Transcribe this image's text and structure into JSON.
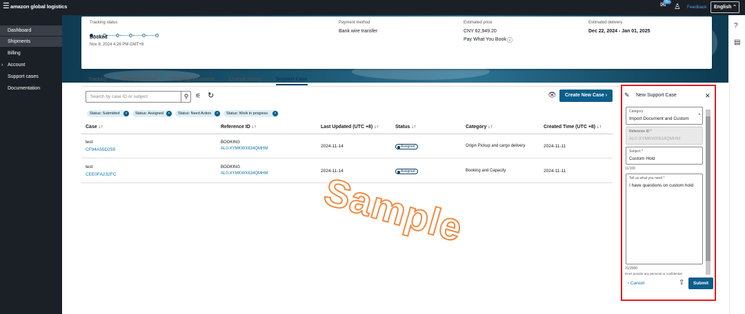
{
  "topbar": {
    "menu_icon": "hamburger-icon",
    "brand": "amazon global logistics",
    "gift_badge": "99+",
    "feedback": "Feedback",
    "language": "English"
  },
  "sidenav": {
    "items": [
      {
        "label": "Dashboard",
        "active": true
      },
      {
        "label": "Shipments",
        "active": true
      },
      {
        "label": "Billing",
        "active": false
      },
      {
        "label": "Account",
        "active": false,
        "expandable": true
      },
      {
        "label": "Support cases",
        "active": false
      },
      {
        "label": "Documentation",
        "active": false
      }
    ]
  },
  "summary": {
    "tracking_status_label": "Tracking status",
    "tracking_status_value": "Booked",
    "tracking_status_time": "Nov 8, 2024 4:26 PM GMT+8",
    "payment_method_label": "Payment method",
    "payment_method_value": "Bank wire transfer",
    "estimated_price_label": "Estimated price",
    "estimated_price_value": "CNY 62,949.20",
    "pay_what_you_book": "Pay What You Book",
    "estimated_delivery_label": "Estimated delivery",
    "estimated_delivery_value": "Dec 22, 2024 - Jan 01, 2025"
  },
  "tabs": [
    "Tracking",
    "Shipment details",
    "Shipping documents",
    "Change history",
    "Support Case"
  ],
  "toolbar": {
    "search_placeholder": "Search by case ID or subject",
    "create_label": "Create New Case"
  },
  "filters": [
    "Status: Submitted",
    "Status: Assigned",
    "Status: Need Action",
    "Status: Work in progress"
  ],
  "table": {
    "headers": [
      "Case ↓↑",
      "Reference ID ↓↑",
      "Last Updated (UTC +8) ↓↑",
      "Status ↓↑",
      "Category ↓↑",
      "Created Time (UTC +8) ↓↑"
    ],
    "rows": [
      {
        "case_name": "test",
        "case_id": "CF94A55D259",
        "ref_type": "BOOKING",
        "ref_id": "AL0-XYMKWX634QMHM",
        "updated": "2024-11-14",
        "status": "Assigned",
        "category": "Origin Pickup and cargo delivery",
        "created": "2024-11-11"
      },
      {
        "case_name": "test",
        "case_id": "CEE0FA232FC",
        "ref_type": "BOOKING",
        "ref_id": "AL0-XYMKWX634QMHM",
        "updated": "2024-11-14",
        "status": "Assigned",
        "category": "Booking and Capacity",
        "created": "2024-11-11"
      }
    ]
  },
  "watermark": "Sample",
  "panel": {
    "title": "New Support Case",
    "category_label": "Category",
    "category_value": "Import Document and Custom",
    "reference_label": "Reference ID *",
    "reference_value": "AL0-XYMKWX634QMHM",
    "subject_label": "Subject *",
    "subject_value": "Custom Hold",
    "subject_count": "11/100",
    "need_label": "Tell us what you need *",
    "need_value": "I have questions on custom hold",
    "need_count": "31/2000",
    "hint": "Don't provide any personal or confidential",
    "cancel": "Cancel",
    "submit": "Submit"
  }
}
